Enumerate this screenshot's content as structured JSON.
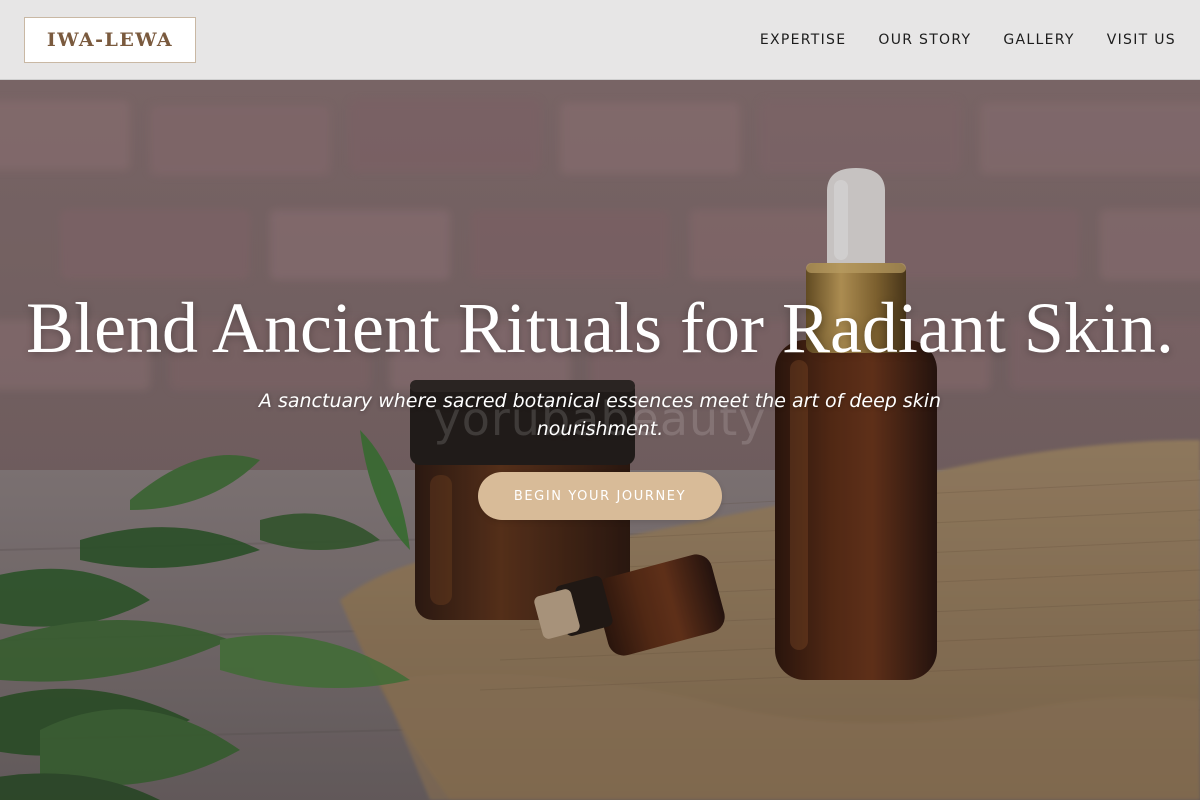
{
  "header": {
    "logo_text": "IWA-LEWA",
    "nav": [
      {
        "label": "EXPERTISE"
      },
      {
        "label": "OUR STORY"
      },
      {
        "label": "GALLERY"
      },
      {
        "label": "VISIT US"
      }
    ]
  },
  "hero": {
    "title": "Blend Ancient Rituals for Radiant Skin.",
    "subtitle": "A sanctuary where sacred botanical essences meet the art of deep skin nourishment.",
    "cta_label": "BEGIN YOUR JOURNEY",
    "watermark_text": "yorubabeauty"
  },
  "colors": {
    "header_bg": "#e7e6e6",
    "logo_text": "#7a5a3e",
    "cta_bg": "#d8bb98",
    "hero_text": "#ffffff"
  }
}
